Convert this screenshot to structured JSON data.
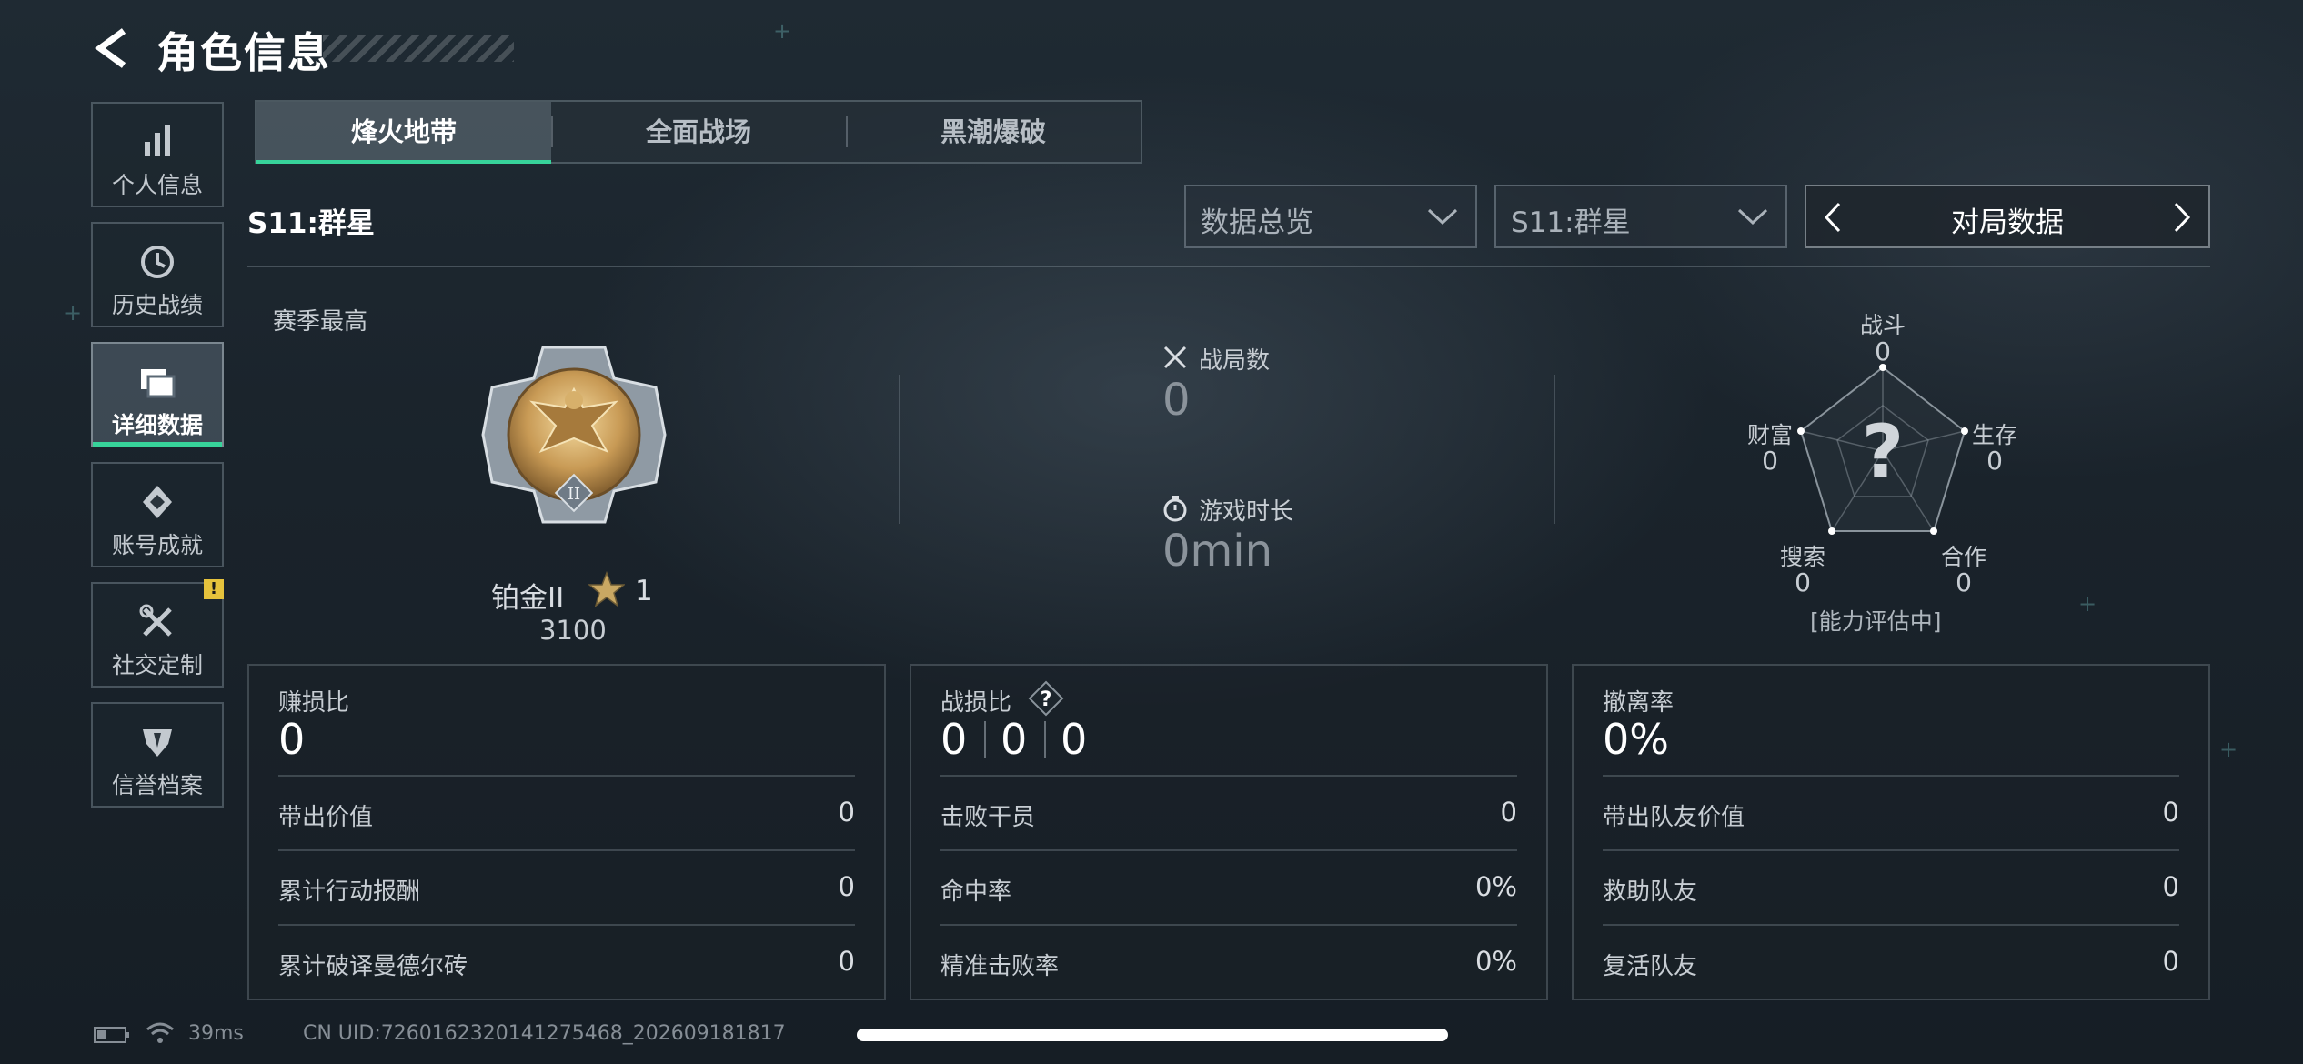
{
  "header": {
    "title": "角色信息"
  },
  "sidebar": {
    "items": [
      {
        "label": "个人信息",
        "icon": "bar-chart-icon"
      },
      {
        "label": "历史战绩",
        "icon": "clock-icon"
      },
      {
        "label": "详细数据",
        "icon": "cards-icon",
        "active": true
      },
      {
        "label": "账号成就",
        "icon": "achievement-icon"
      },
      {
        "label": "社交定制",
        "icon": "tools-icon",
        "badge": "!"
      },
      {
        "label": "信誉档案",
        "icon": "shield-icon"
      }
    ]
  },
  "tabs": [
    {
      "label": "烽火地带",
      "active": true
    },
    {
      "label": "全面战场"
    },
    {
      "label": "黑潮爆破"
    }
  ],
  "season_label": "S11:群星",
  "filters": {
    "overview": "数据总览",
    "season": "S11:群星",
    "data_type": "对局数据"
  },
  "rank": {
    "section_label": "赛季最高",
    "name": "铂金II",
    "stars": "1",
    "score": "3100"
  },
  "stats": {
    "matches_label": "战局数",
    "matches_value": "0",
    "playtime_label": "游戏时长",
    "playtime_value": "0min"
  },
  "radar": {
    "center": "?",
    "status": "[能力评估中]",
    "axes": [
      {
        "label": "战斗",
        "value": "0"
      },
      {
        "label": "生存",
        "value": "0"
      },
      {
        "label": "合作",
        "value": "0"
      },
      {
        "label": "搜索",
        "value": "0"
      },
      {
        "label": "财富",
        "value": "0"
      }
    ]
  },
  "panels": {
    "profit": {
      "title": "赚损比",
      "value": "0",
      "rows": [
        {
          "label": "带出价值",
          "value": "0"
        },
        {
          "label": "累计行动报酬",
          "value": "0"
        },
        {
          "label": "累计破译曼德尔砖",
          "value": "0"
        }
      ]
    },
    "combat": {
      "title": "战损比",
      "values": [
        "0",
        "0",
        "0"
      ],
      "rows": [
        {
          "label": "击败干员",
          "value": "0"
        },
        {
          "label": "命中率",
          "value": "0%"
        },
        {
          "label": "精准击败率",
          "value": "0%"
        }
      ]
    },
    "extract": {
      "title": "撤离率",
      "value": "0%",
      "rows": [
        {
          "label": "带出队友价值",
          "value": "0"
        },
        {
          "label": "救助队友",
          "value": "0"
        },
        {
          "label": "复活队友",
          "value": "0"
        }
      ]
    }
  },
  "footer": {
    "ping": "39ms",
    "uid": "CN UID:7260162320141275468_202609181817"
  },
  "colors": {
    "accent": "#37d39a",
    "badge": "#e5c23c"
  }
}
